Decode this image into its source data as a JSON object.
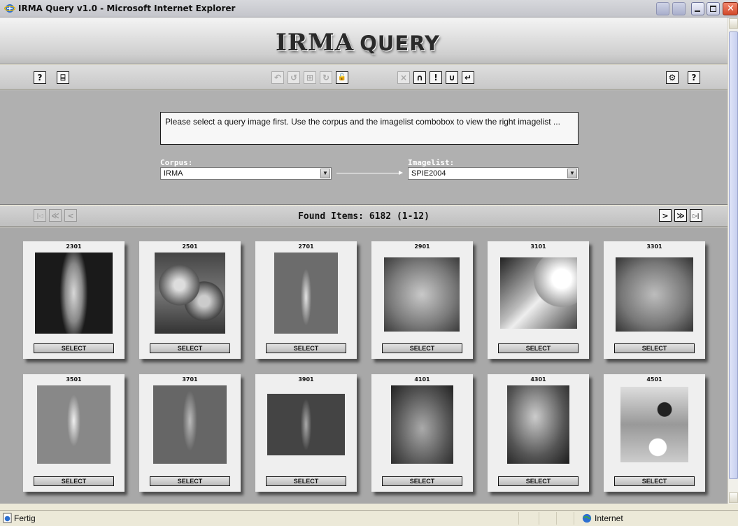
{
  "window": {
    "title": "IRMA Query v1.0 - Microsoft Internet Explorer"
  },
  "banner": {
    "logo_left": "IRMA",
    "logo_right": "QUERY"
  },
  "toolbar": {
    "left": [
      {
        "icon": "help-arrow-icon",
        "glyph": "?"
      },
      {
        "icon": "open-folder-icon",
        "glyph": "⌸"
      }
    ],
    "center": [
      {
        "icon": "undo-all-icon",
        "glyph": "↶",
        "disabled": true
      },
      {
        "icon": "undo-icon",
        "glyph": "↺",
        "disabled": true
      },
      {
        "icon": "grid-icon",
        "glyph": "⊞",
        "disabled": true
      },
      {
        "icon": "redo-icon",
        "glyph": "↻",
        "disabled": true
      },
      {
        "icon": "unlock-icon",
        "glyph": "🔓",
        "disabled": false
      }
    ],
    "ops": [
      {
        "icon": "clear-icon",
        "glyph": "×",
        "disabled": true
      },
      {
        "icon": "intersection-icon",
        "glyph": "∩",
        "disabled": false
      },
      {
        "icon": "not-icon",
        "glyph": "!",
        "disabled": false
      },
      {
        "icon": "union-icon",
        "glyph": "∪",
        "disabled": false
      },
      {
        "icon": "enter-icon",
        "glyph": "↵",
        "disabled": false
      }
    ],
    "right": [
      {
        "icon": "settings-icon",
        "glyph": "⚙"
      },
      {
        "icon": "help-icon",
        "glyph": "?"
      }
    ]
  },
  "query": {
    "message": "Please select a query image first. Use the corpus and the imagelist combobox to view the right imagelist ...",
    "corpus_label": "Corpus:",
    "corpus_value": "IRMA",
    "imagelist_label": "Imagelist:",
    "imagelist_value": "SPIE2004"
  },
  "nav": {
    "found_text": "Found Items: 6182 (1-12)",
    "first": "|◁",
    "prev_page": "≪",
    "prev": "<",
    "next": ">",
    "next_page": "≫",
    "last": "▷|"
  },
  "items": [
    {
      "id": "2301",
      "select": "SELECT"
    },
    {
      "id": "2501",
      "select": "SELECT"
    },
    {
      "id": "2701",
      "select": "SELECT"
    },
    {
      "id": "2901",
      "select": "SELECT"
    },
    {
      "id": "3101",
      "select": "SELECT"
    },
    {
      "id": "3301",
      "select": "SELECT"
    },
    {
      "id": "3501",
      "select": "SELECT"
    },
    {
      "id": "3701",
      "select": "SELECT"
    },
    {
      "id": "3901",
      "select": "SELECT"
    },
    {
      "id": "4101",
      "select": "SELECT"
    },
    {
      "id": "4301",
      "select": "SELECT"
    },
    {
      "id": "4501",
      "select": "SELECT"
    }
  ],
  "status": {
    "text": "Fertig",
    "zone": "Internet"
  }
}
